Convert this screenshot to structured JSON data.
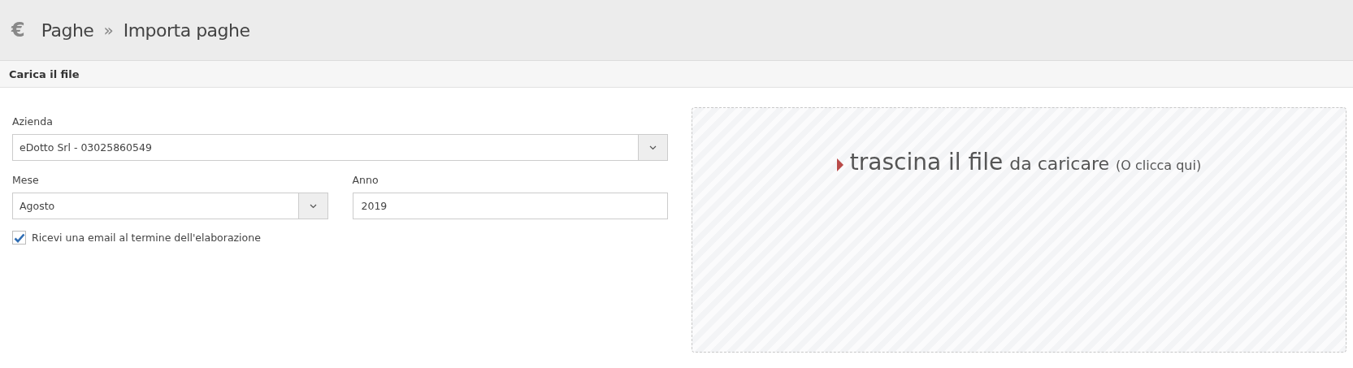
{
  "breadcrumb": {
    "icon": "€",
    "items": [
      "Paghe",
      "Importa paghe"
    ],
    "separator": "»"
  },
  "panel": {
    "title": "Carica il file"
  },
  "form": {
    "company": {
      "label": "Azienda",
      "value": "eDotto Srl - 03025860549"
    },
    "month": {
      "label": "Mese",
      "value": "Agosto"
    },
    "year": {
      "label": "Anno",
      "value": "2019"
    },
    "email_checkbox": {
      "label": "Ricevi una email al termine dell'elaborazione",
      "checked": true
    }
  },
  "dropzone": {
    "main": "trascina il file",
    "secondary": "da caricare",
    "hint": "(O clicca qui)"
  }
}
